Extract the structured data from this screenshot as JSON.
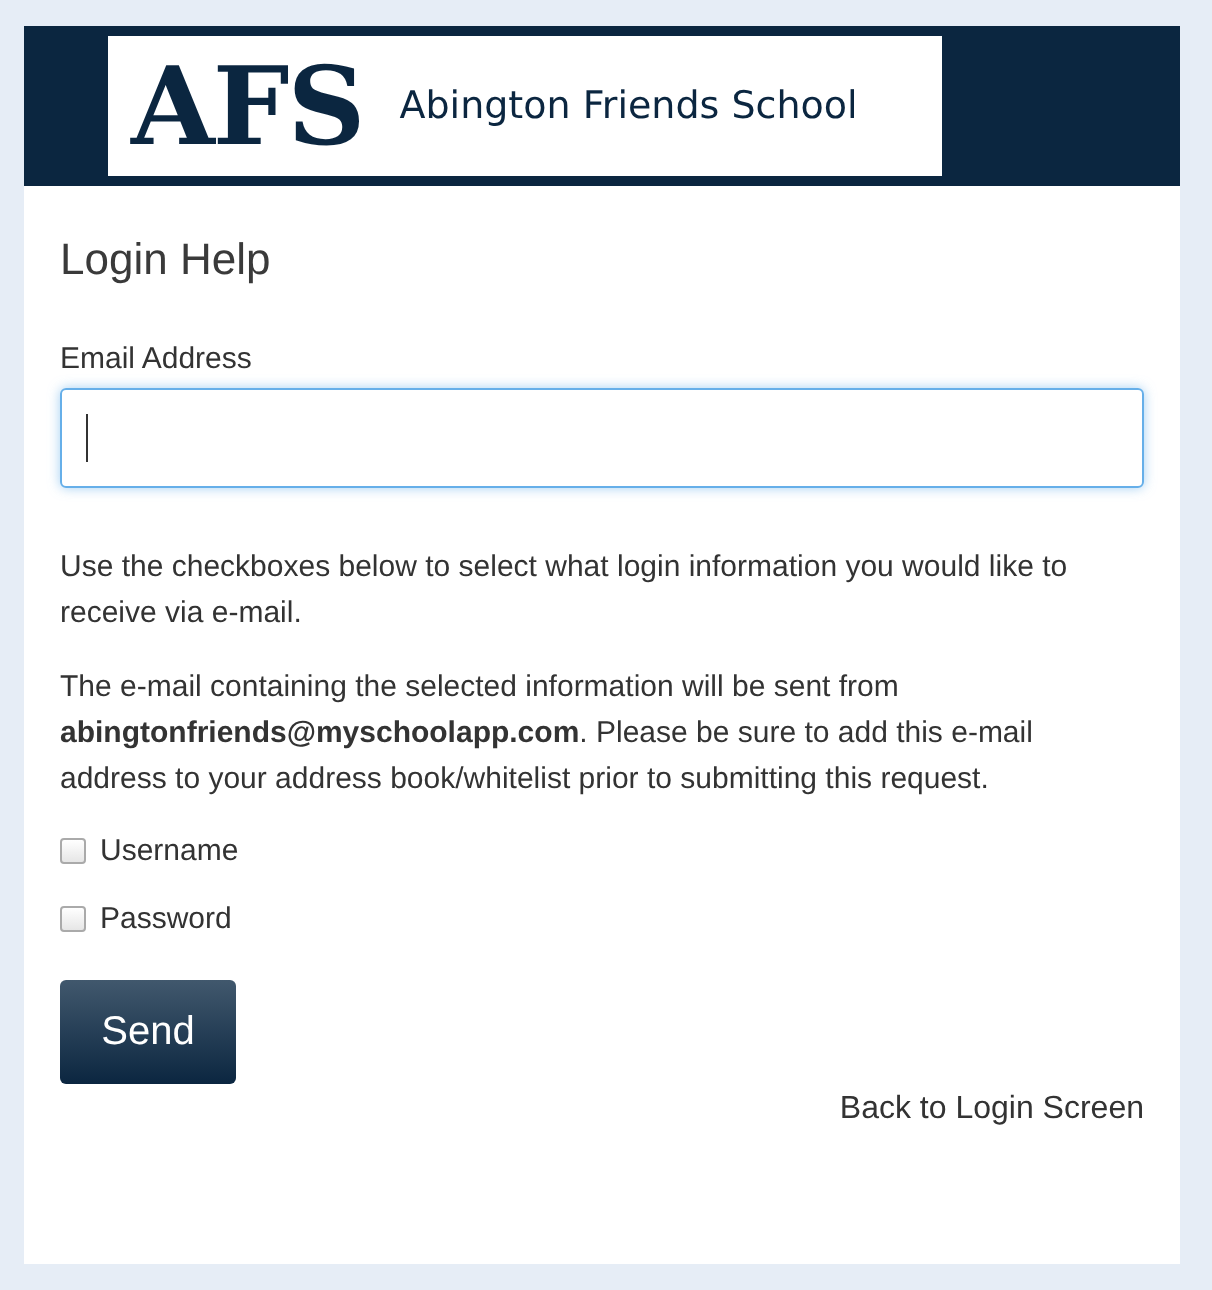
{
  "logo": {
    "mark": "AFS",
    "name": "Abington Friends School"
  },
  "title": "Login Help",
  "email_field": {
    "label": "Email Address",
    "focused": true
  },
  "paragraphs": [
    "Use the checkboxes below to select what login information you would like to receive via e-mail.",
    "The e-mail containing the selected information will be sent from **abingtonfriends@myschoolapp.com**. Please be sure to add this e-mail address to your address book/whitelist prior to submitting this request."
  ],
  "options": [
    {
      "label": "Username",
      "checked": false
    },
    {
      "label": "Password",
      "checked": false
    }
  ],
  "send_button": "Send",
  "back_link": "Back to Login Screen"
}
